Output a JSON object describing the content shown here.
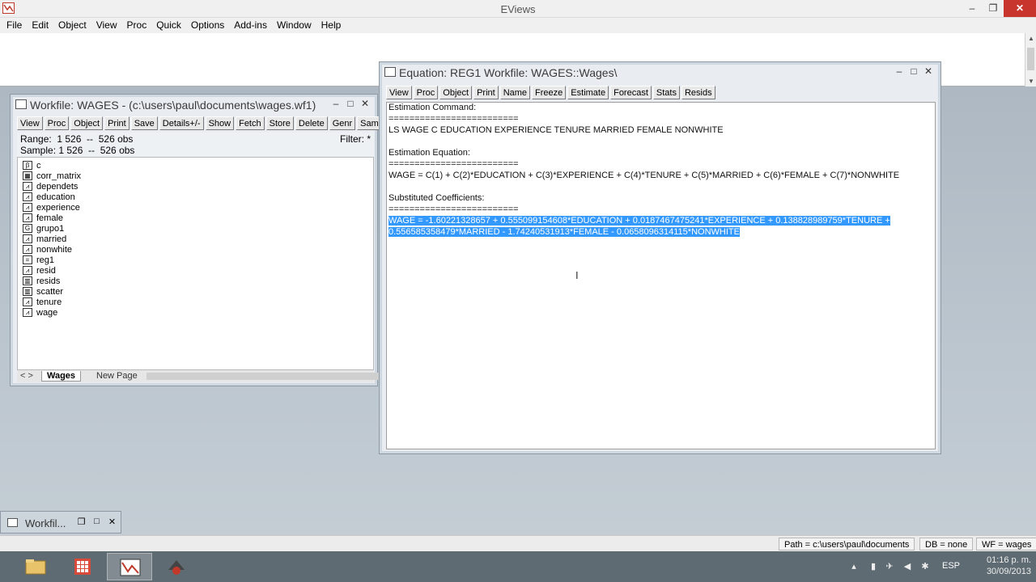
{
  "app": {
    "title": "EViews",
    "controls": {
      "minimize": "–",
      "restore": "❐",
      "close": "✕"
    }
  },
  "menu": [
    "File",
    "Edit",
    "Object",
    "View",
    "Proc",
    "Quick",
    "Options",
    "Add-ins",
    "Window",
    "Help"
  ],
  "workfile_window": {
    "title": "Workfile: WAGES - (c:\\users\\paul\\documents\\wages.wf1)",
    "toolbar": [
      "View",
      "Proc",
      "Object",
      "Print",
      "Save",
      "Details+/-",
      "Show",
      "Fetch",
      "Store",
      "Delete",
      "Genr",
      "Sample"
    ],
    "range_text": "Range:  1 526  --  526 obs",
    "sample_text": "Sample: 1 526  --  526 obs",
    "filter_text": "Filter: *",
    "objects": [
      {
        "name": "c",
        "icon": "coef-icon",
        "glyph": "β"
      },
      {
        "name": "corr_matrix",
        "icon": "matrix-icon",
        "glyph": "▦"
      },
      {
        "name": "dependets",
        "icon": "series-icon",
        "glyph": "⩘"
      },
      {
        "name": "education",
        "icon": "series-icon",
        "glyph": "⩘"
      },
      {
        "name": "experience",
        "icon": "series-icon",
        "glyph": "⩘"
      },
      {
        "name": "female",
        "icon": "series-icon",
        "glyph": "⩘"
      },
      {
        "name": "grupo1",
        "icon": "group-icon",
        "glyph": "G"
      },
      {
        "name": "married",
        "icon": "series-icon",
        "glyph": "⩘"
      },
      {
        "name": "nonwhite",
        "icon": "series-icon",
        "glyph": "⩘"
      },
      {
        "name": "reg1",
        "icon": "equation-icon",
        "glyph": "="
      },
      {
        "name": "resid",
        "icon": "series-icon",
        "glyph": "⩘"
      },
      {
        "name": "resids",
        "icon": "graph-icon",
        "glyph": "▥"
      },
      {
        "name": "scatter",
        "icon": "graph-icon",
        "glyph": "▥"
      },
      {
        "name": "tenure",
        "icon": "series-icon",
        "glyph": "⩘"
      },
      {
        "name": "wage",
        "icon": "series-icon",
        "glyph": "⩘"
      }
    ],
    "tabs": {
      "nav": "< >",
      "active": "Wages",
      "new": "New Page"
    }
  },
  "equation_window": {
    "title": "Equation: REG1   Workfile: WAGES::Wages\\",
    "toolbar": [
      "View",
      "Proc",
      "Object",
      "Print",
      "Name",
      "Freeze",
      "Estimate",
      "Forecast",
      "Stats",
      "Resids"
    ],
    "lines": [
      "Estimation Command:",
      "=========================",
      "LS WAGE C EDUCATION EXPERIENCE TENURE MARRIED FEMALE NONWHITE",
      "",
      "Estimation Equation:",
      "=========================",
      "WAGE = C(1) + C(2)*EDUCATION + C(3)*EXPERIENCE + C(4)*TENURE + C(5)*MARRIED + C(6)*FEMALE + C(7)*NONWHITE",
      "",
      "Substituted Coefficients:",
      "========================="
    ],
    "selected_lines": [
      "WAGE = -1.60221328657 + 0.555099154608*EDUCATION + 0.0187467475241*EXPERIENCE + 0.138828989759*TENURE +",
      "0.556585358479*MARRIED - 1.74240531913*FEMALE - 0.0658096314115*NONWHITE"
    ]
  },
  "minimized_window": {
    "title": "Workfil..."
  },
  "statusbar": {
    "path": "Path = c:\\users\\paul\\documents",
    "db": "DB = none",
    "wf": "WF = wages"
  },
  "taskbar": {
    "apps": [
      "file-explorer-icon",
      "apps-grid-icon",
      "eviews-icon",
      "app-icon"
    ],
    "language": "ESP",
    "time": "01:16 p. m.",
    "date": "30/09/2013"
  }
}
